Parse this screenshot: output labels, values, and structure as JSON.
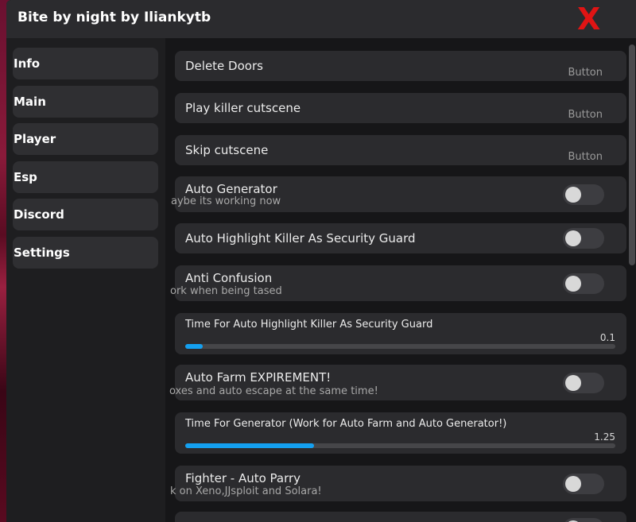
{
  "window": {
    "title": "Bite by night by Iliankytb",
    "close_label": "X",
    "accent": "#14a0f0",
    "close_color": "#e01414"
  },
  "sidebar": {
    "items": [
      {
        "label": "Info"
      },
      {
        "label": "Main"
      },
      {
        "label": "Player"
      },
      {
        "label": "Esp"
      },
      {
        "label": "Discord"
      },
      {
        "label": "Settings"
      }
    ]
  },
  "content": {
    "delete_doors": {
      "title": "Delete Doors",
      "hint": "Button"
    },
    "play_killer_cutscene": {
      "title": "Play killer cutscene",
      "hint": "Button"
    },
    "skip_cutscene": {
      "title": "Skip cutscene",
      "hint": "Button"
    },
    "auto_generator": {
      "title": "Auto Generator",
      "sub": "aybe its working now",
      "enabled": false
    },
    "auto_highlight": {
      "title": "Auto Highlight Killer As Security Guard",
      "enabled": false
    },
    "anti_confusion": {
      "title": "Anti Confusion",
      "sub": "ork when being tased",
      "enabled": false
    },
    "time_highlight": {
      "title": "Time For Auto Highlight Killer As Security Guard",
      "value": "0.1",
      "fill_percent": 4
    },
    "auto_farm": {
      "title": "Auto Farm EXPIREMENT!",
      "sub": "oxes and auto escape at the same time!",
      "enabled": false
    },
    "time_generator": {
      "title": "Time For Generator (Work for Auto Farm and Auto Generator!)",
      "value": "1.25",
      "fill_percent": 30
    },
    "fighter_parry": {
      "title": "Fighter - Auto Parry",
      "sub": "k on Xeno,JJsploit and Solara!",
      "enabled": false
    }
  }
}
